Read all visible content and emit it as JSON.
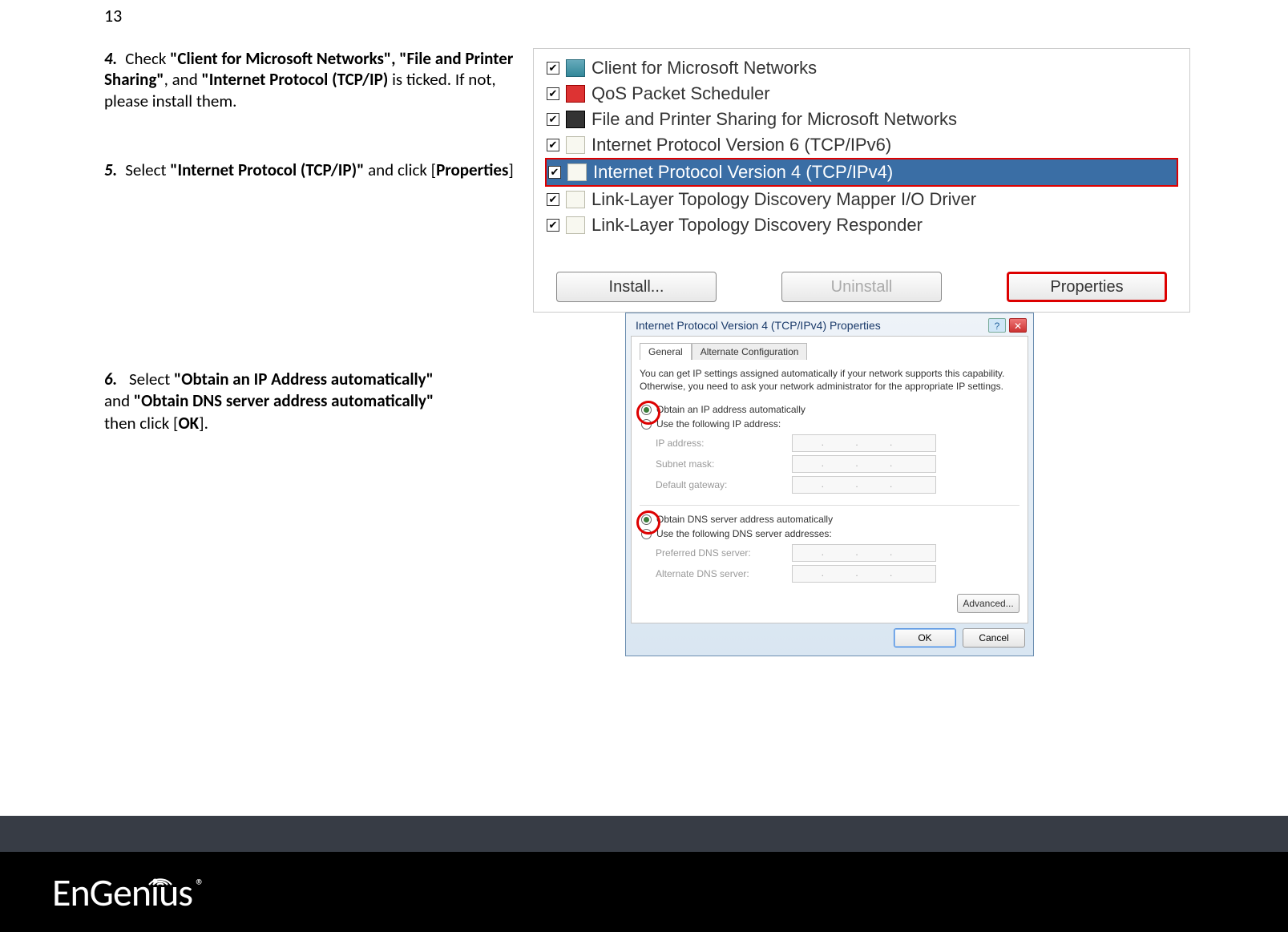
{
  "page_number": "13",
  "steps": {
    "s4": {
      "num": "4.",
      "t1": "Check ",
      "b1": "\"Client for Microsoft Networks\", \"File and Printer Sharing\"",
      "t2": ", and ",
      "b2": "\"Internet Protocol (TCP/IP)",
      "t3": " is ticked. If not, please install them."
    },
    "s5": {
      "num": "5.",
      "t1": "Select ",
      "b1": "\"Internet Protocol (TCP/IP)\"",
      "t2": " and click [",
      "b2": "Properties",
      "t3": "]"
    },
    "s6": {
      "num": "6.",
      "t1": "Select ",
      "b1": "\"Obtain an IP Address automatically\"",
      "t2": " and ",
      "b2": "\"Obtain DNS server address automatically\"",
      "t3": " then click [",
      "b3": "OK",
      "t4": "]."
    }
  },
  "protocol_list": {
    "items": [
      "Client for Microsoft Networks",
      "QoS Packet Scheduler",
      "File and Printer Sharing for Microsoft Networks",
      "Internet Protocol Version 6 (TCP/IPv6)",
      "Internet Protocol Version 4 (TCP/IPv4)",
      "Link-Layer Topology Discovery Mapper I/O Driver",
      "Link-Layer Topology Discovery Responder"
    ],
    "buttons": {
      "install": "Install...",
      "uninstall": "Uninstall",
      "properties": "Properties"
    }
  },
  "tcpip_dialog": {
    "title": "Internet Protocol Version 4 (TCP/IPv4) Properties",
    "tabs": {
      "general": "General",
      "alt": "Alternate Configuration"
    },
    "desc": "You can get IP settings assigned automatically if your network supports this capability. Otherwise, you need to ask your network administrator for the appropriate IP settings.",
    "r_obtain_ip": "Obtain an IP address automatically",
    "r_use_ip": "Use the following IP address:",
    "f_ip": "IP address:",
    "f_subnet": "Subnet mask:",
    "f_gateway": "Default gateway:",
    "r_obtain_dns": "Obtain DNS server address automatically",
    "r_use_dns": "Use the following DNS server addresses:",
    "f_pref_dns": "Preferred DNS server:",
    "f_alt_dns": "Alternate DNS server:",
    "btn_adv": "Advanced...",
    "btn_ok": "OK",
    "btn_cancel": "Cancel",
    "ip_dots": ".   .   ."
  },
  "footer": {
    "brand_en": "En",
    "brand_gen": "Gen",
    "brand_i": "i",
    "brand_us": "us",
    "reg": "®"
  }
}
